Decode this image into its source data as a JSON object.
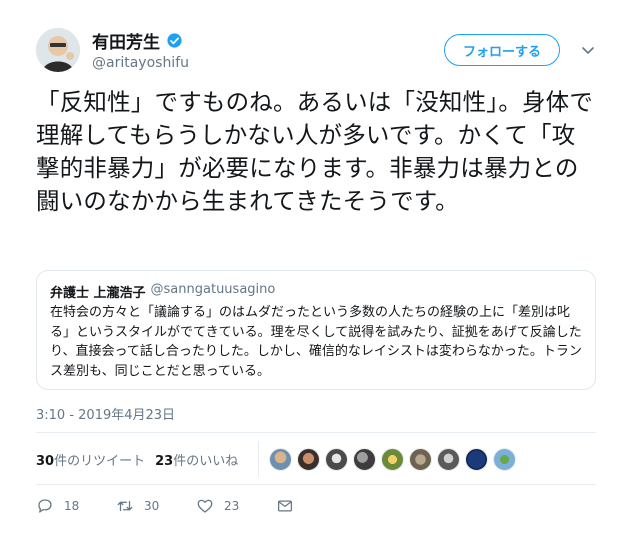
{
  "author": {
    "name": "有田芳生",
    "handle": "@aritayoshifu",
    "verified": true
  },
  "follow_button": "フォローする",
  "tweet_text": "「反知性」ですものね。あるいは「没知性」。身体で理解してもらうしかない人が多いです。かくて「攻撃的非暴力」が必要になります。非暴力は暴力との闘いのなかから生まれてきたそうです。",
  "quote": {
    "name": "弁護士 上瀧浩子",
    "handle": "@sanngatuusagino",
    "text": "在特会の方々と「議論する」のはムダだったという多数の人たちの経験の上に「差別は叱る」というスタイルがでてきている。理を尽くして説得を試みたり、証拠をあげて反論したり、直接会って話し合ったりした。しかし、確信的なレイシストは変わらなかった。トランス差別も、同じことだと思っている。"
  },
  "timestamp": "3:10 - 2019年4月23日",
  "stats": {
    "retweets_count": "30",
    "retweets_label": "件のリツイート",
    "likes_count": "23",
    "likes_label": "件のいいね"
  },
  "likers_count": 9,
  "actions": {
    "reply_count": "18",
    "retweet_count": "30",
    "like_count": "23"
  },
  "colors": {
    "accent": "#1da1f2",
    "muted": "#657786",
    "text": "#14171a",
    "border": "#e1e8ed"
  },
  "icons": [
    "verified-badge-icon",
    "chevron-down-icon",
    "reply-icon",
    "retweet-icon",
    "like-icon",
    "message-icon"
  ]
}
